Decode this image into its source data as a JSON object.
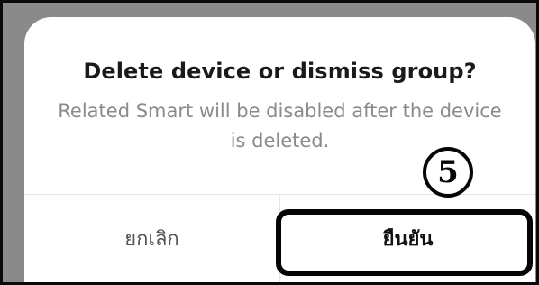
{
  "dialog": {
    "title": "Delete device or dismiss group?",
    "message": "Related Smart will be disabled after the device is deleted.",
    "cancel_label": "ยกเลิก",
    "confirm_label": "ยืนยัน"
  },
  "annotation": {
    "step_number": "5"
  },
  "colors": {
    "backdrop": "#8a8a8a",
    "dialog_background": "#ffffff",
    "title_text": "#1a1a1a",
    "message_text": "#8a8a8a",
    "highlight_border": "#050505"
  }
}
